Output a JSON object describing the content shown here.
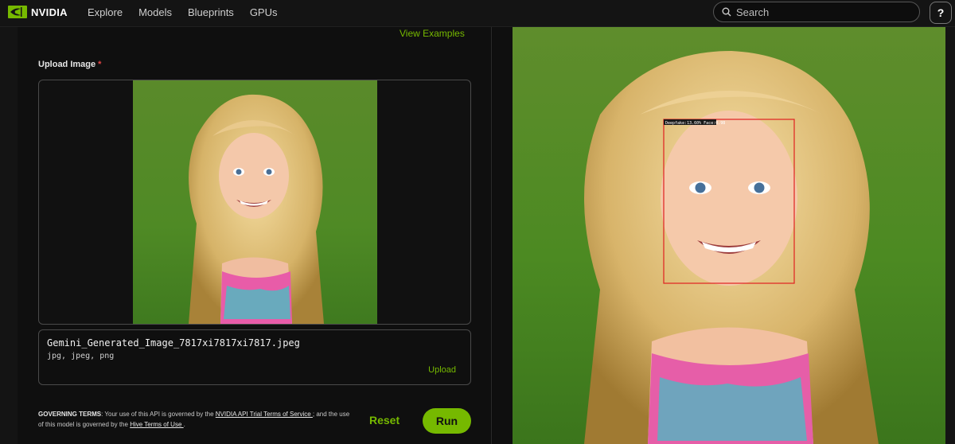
{
  "brand": {
    "name": "NVIDIA",
    "accent": "#76b900"
  },
  "nav": {
    "items": [
      "Explore",
      "Models",
      "Blueprints",
      "GPUs"
    ]
  },
  "search": {
    "placeholder": "Search"
  },
  "help": {
    "label": "?"
  },
  "left_panel": {
    "view_examples": "View Examples",
    "upload_label": "Upload Image",
    "required_mark": "*",
    "file": {
      "name": "Gemini_Generated_Image_7817xi7817xi7817.jpeg",
      "types": "jpg, jpeg, png",
      "upload_label": "Upload"
    },
    "terms": {
      "heading": "GOVERNING TERMS",
      "text_1": ": Your use of this API is governed by the ",
      "link_1": "NVIDIA API Trial Terms of Service ",
      "text_2": "; and the use of this model is governed by the ",
      "link_2": "Hive Terms of Use ",
      "text_3": "."
    },
    "reset_label": "Reset",
    "run_label": "Run"
  },
  "result": {
    "detection_label": "Deepfake:13.60% Face:0.98"
  }
}
